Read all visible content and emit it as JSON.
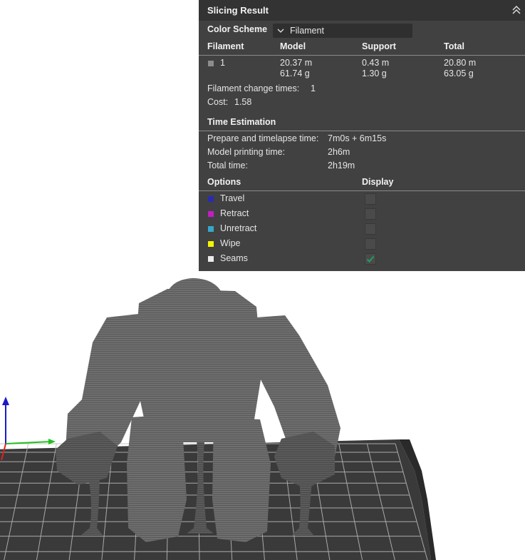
{
  "panel": {
    "title": "Slicing Result",
    "color_scheme_label": "Color Scheme",
    "color_scheme_value": "Filament",
    "filament_table": {
      "headers": [
        "Filament",
        "Model",
        "Support",
        "Total"
      ],
      "row": {
        "filament": "1",
        "swatch_color": "#8c8c8c",
        "model_length": "20.37 m",
        "model_weight": "61.74 g",
        "support_length": "0.43 m",
        "support_weight": "1.30 g",
        "total_length": "20.80 m",
        "total_weight": "63.05 g"
      }
    },
    "filament_change_label": "Filament change times:",
    "filament_change_value": "1",
    "cost_label": "Cost:",
    "cost_value": "1.58",
    "time_section_title": "Time Estimation",
    "time_rows": [
      {
        "label": "Prepare and timelapse time:",
        "value": "7m0s + 6m15s"
      },
      {
        "label": "Model printing time:",
        "value": "2h6m"
      },
      {
        "label": "Total time:",
        "value": "2h19m"
      }
    ],
    "options_header": "Options",
    "display_header": "Display",
    "options": [
      {
        "label": "Travel",
        "color": "#2b2bb0",
        "checked": false
      },
      {
        "label": "Retract",
        "color": "#c51cc5",
        "checked": false
      },
      {
        "label": "Unretract",
        "color": "#35a8c8",
        "checked": false
      },
      {
        "label": "Wipe",
        "color": "#f5f500",
        "checked": false
      },
      {
        "label": "Seams",
        "color": "#ebebeb",
        "checked": true
      }
    ],
    "collapse_icon": "double-chevron-up-icon"
  },
  "viewport": {
    "model_color": "#6e6e6e",
    "bed_color": "#3a3a3a",
    "axis_colors": {
      "x": "#e02020",
      "y": "#20c020",
      "z": "#1a1ac8"
    }
  }
}
